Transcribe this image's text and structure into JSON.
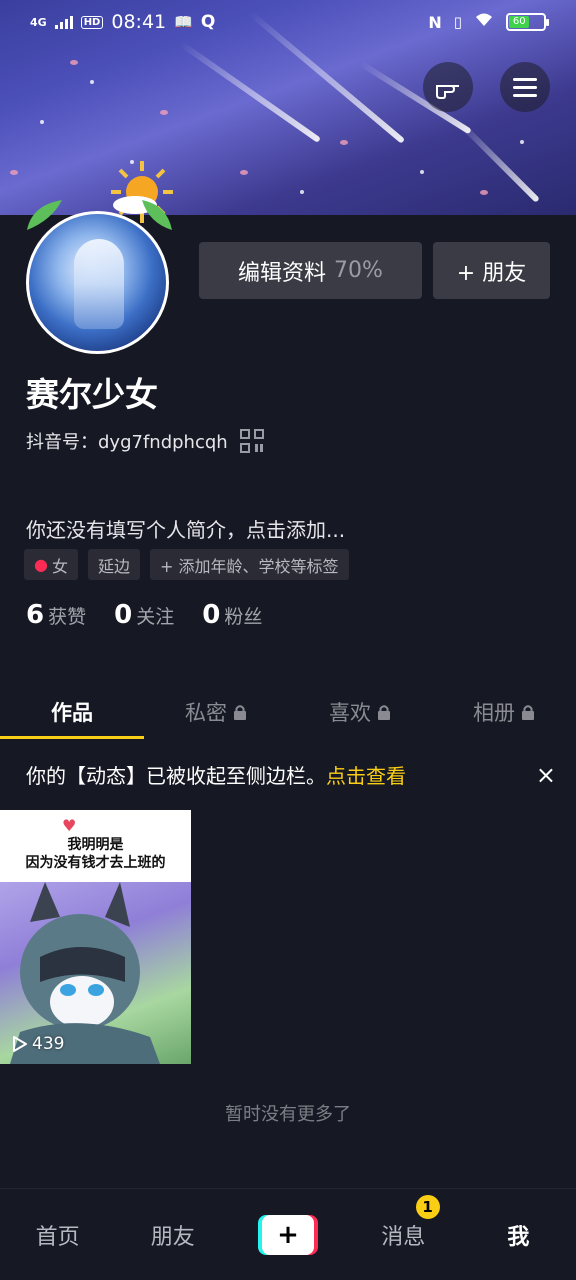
{
  "status_bar": {
    "network": "4G",
    "hd": "HD",
    "time": "08:41",
    "battery_level": "60",
    "battery_color": "#3fd24a"
  },
  "header": {
    "left_action_icon": "pointing-hand-icon",
    "menu_icon": "hamburger-menu-icon"
  },
  "profile": {
    "edit_button_label": "编辑资料",
    "edit_completion": "70%",
    "add_friend_label": "+ 朋友",
    "name": "赛尔少女",
    "douyin_id": "抖音号：dyg7fndphcqh",
    "bio_placeholder": "你还没有填写个人简介，点击添加...",
    "tags": [
      "女",
      "延边",
      "+ 添加年龄、学校等标签"
    ],
    "stats": [
      {
        "num": "6",
        "label": "获赞"
      },
      {
        "num": "0",
        "label": "关注"
      },
      {
        "num": "0",
        "label": "粉丝"
      }
    ]
  },
  "tabs": [
    {
      "label": "作品",
      "active": true,
      "locked": false
    },
    {
      "label": "私密",
      "active": false,
      "locked": true
    },
    {
      "label": "喜欢",
      "active": false,
      "locked": true
    },
    {
      "label": "相册",
      "active": false,
      "locked": true
    }
  ],
  "notice": {
    "text": "你的【动态】已被收起至侧边栏。",
    "link": "点击查看",
    "close": "×"
  },
  "videos": [
    {
      "caption_line1": "我明明是",
      "caption_line2": "因为没有钱才去上班的",
      "plays": "439"
    }
  ],
  "empty_text": "暂时没有更多了",
  "bottom_nav": {
    "home": "首页",
    "friends": "朋友",
    "plus": "+",
    "messages": "消息",
    "messages_badge": "1",
    "me": "我"
  },
  "colors": {
    "accent": "#face15",
    "background": "#161823",
    "button": "#3a3b44"
  }
}
